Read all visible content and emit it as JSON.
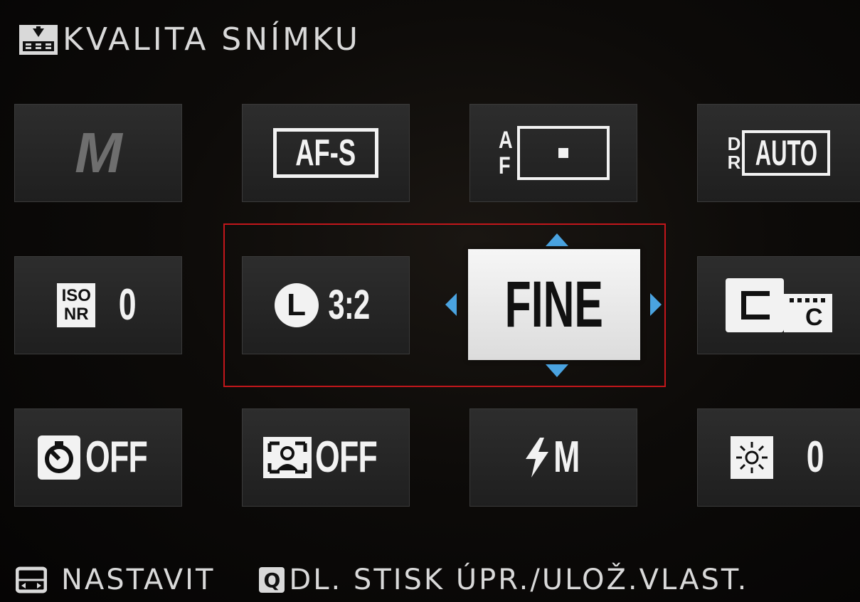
{
  "header": {
    "title": "KVALITA SNÍMKU",
    "icon": "image-quality-icon"
  },
  "tiles": {
    "mode": "M",
    "af_mode": "AF-S",
    "af_area_letters": "AF",
    "dr_letters": "DR",
    "dr_value": "AUTO",
    "iso_nr_line1": "ISO",
    "iso_nr_line2": "NR",
    "iso_nr_value": "0",
    "image_size_letter": "L",
    "image_size_value": "3:2",
    "image_quality_value": "FINE",
    "film_sim_letter": "C",
    "self_timer_value": "OFF",
    "face_detect_value": "OFF",
    "flash_value": "M",
    "brightness_value": "0"
  },
  "footer": {
    "set_label": "NASTAVIT",
    "q_key": "Q",
    "q_label": "DL. STISK ÚPR./ULOŽ.VLAST."
  },
  "colors": {
    "selection_frame": "#c2161b",
    "arrow": "#4aa3e0",
    "selected_bg": "#eeeeee"
  }
}
